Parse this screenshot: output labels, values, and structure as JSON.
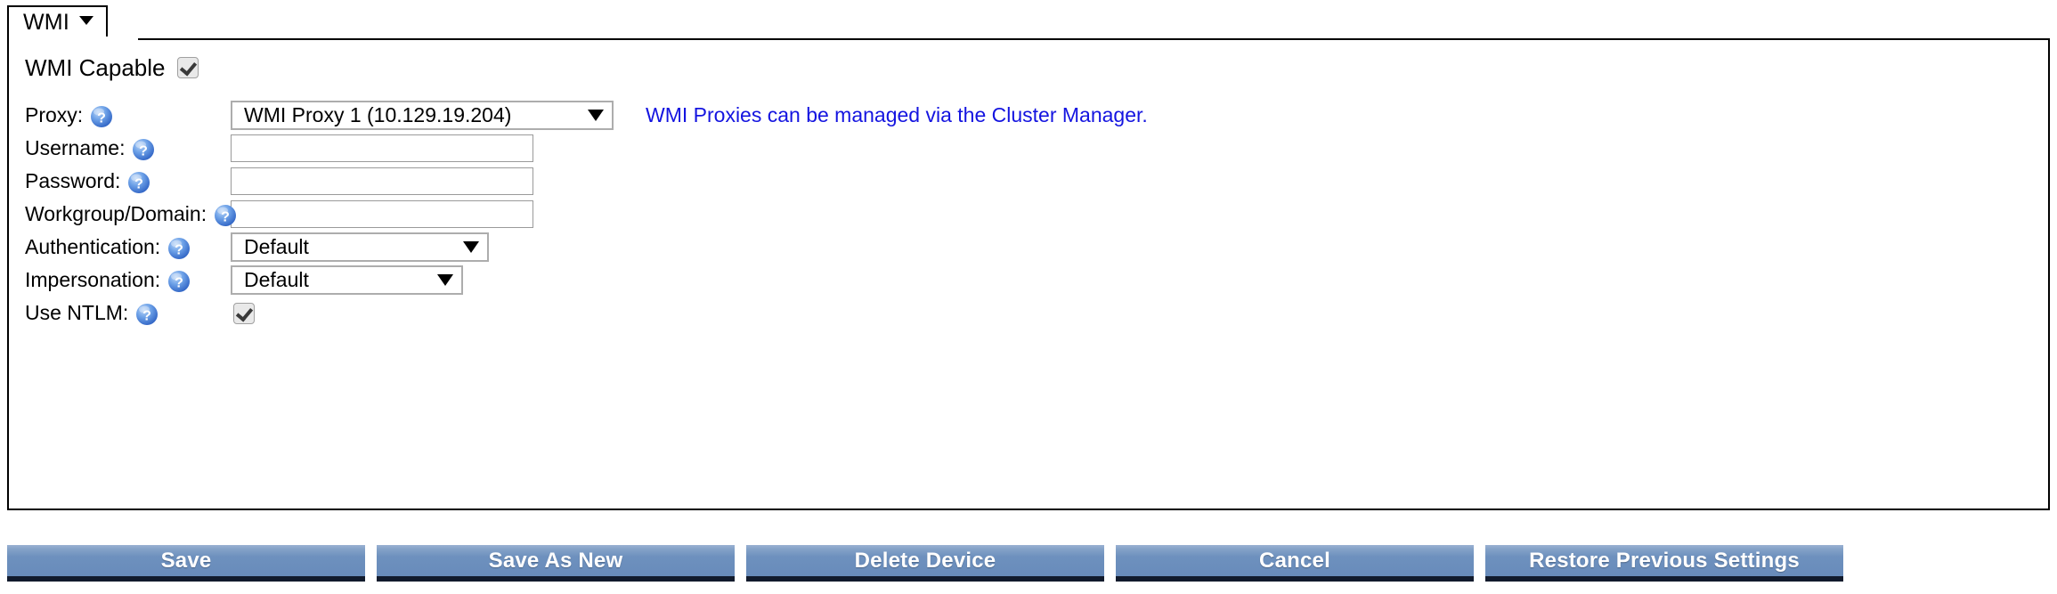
{
  "tab": {
    "label": "WMI",
    "caret_icon": "caret-down-icon"
  },
  "panel": {
    "capability": {
      "label": "WMI Capable",
      "checked": true
    },
    "help_icon_name": "help-icon",
    "rows": [
      {
        "label": "Proxy:",
        "type": "select",
        "value": "WMI Proxy 1 (10.129.19.204)",
        "note": "WMI Proxies can be managed via the Cluster Manager."
      },
      {
        "label": "Username:",
        "type": "text",
        "value": "",
        "placeholder": ""
      },
      {
        "label": "Password:",
        "type": "text",
        "value": "",
        "placeholder": ""
      },
      {
        "label": "Workgroup/Domain:",
        "type": "text",
        "value": "",
        "placeholder": ""
      },
      {
        "label": "Authentication:",
        "type": "select",
        "value": "Default"
      },
      {
        "label": "Impersonation:",
        "type": "select",
        "value": "Default"
      },
      {
        "label": "Use NTLM:",
        "type": "checkbox",
        "checked": true
      }
    ]
  },
  "buttons": [
    {
      "label": "Save"
    },
    {
      "label": "Save As New"
    },
    {
      "label": "Delete Device"
    },
    {
      "label": "Cancel"
    },
    {
      "label": "Restore Previous Settings"
    }
  ],
  "colors": {
    "link": "#1414e0",
    "button_face": "#6c8fbd",
    "button_shadow": "#111a2c",
    "panel_border": "#000000"
  }
}
